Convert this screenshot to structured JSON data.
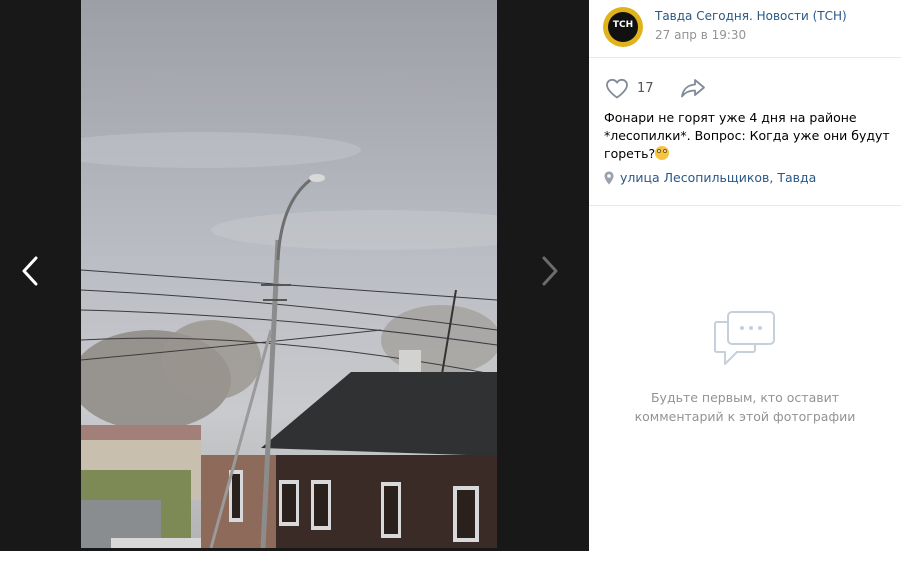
{
  "post": {
    "group_name": "Тавда Сегодня. Новости (ТСН)",
    "date": "27 апр в 19:30",
    "avatar_text": "ТСН",
    "likes_count": "17",
    "text": "Фонари не горят уже 4 дня на районе *лесопилки*. Вопрос: Когда уже они будут гореть?",
    "location": "улица Лесопильщиков, Тавда"
  },
  "comments": {
    "empty_text_line1": "Будьте первым, кто оставит",
    "empty_text_line2": "комментарий к этой фотографии"
  },
  "icons": {
    "prev": "chevron-left-icon",
    "next": "chevron-right-icon",
    "like": "heart-icon",
    "share": "share-arrow-icon",
    "location": "map-pin-icon",
    "comments": "speech-bubble-icon"
  },
  "colors": {
    "viewer_bg": "#181818",
    "link": "#2a5885",
    "muted": "#939393",
    "avatar_ring": "#e0b21c"
  }
}
